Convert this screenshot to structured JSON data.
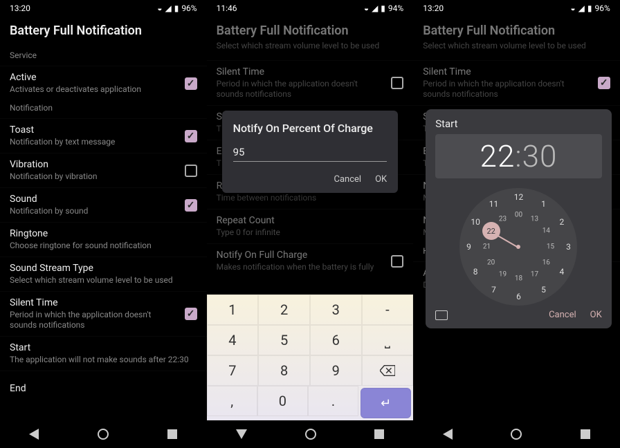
{
  "panels": [
    {
      "time": "13:20",
      "battery": "96%",
      "title": "Battery Full Notification",
      "sections": [
        {
          "header": "Service",
          "items": [
            {
              "title": "Active",
              "summary": "Activates or deactivates application",
              "checked": true
            }
          ]
        },
        {
          "header": "Notification",
          "items": [
            {
              "title": "Toast",
              "summary": "Notification by text message",
              "checked": true
            },
            {
              "title": "Vibration",
              "summary": "Notification by vibration",
              "checked": false
            },
            {
              "title": "Sound",
              "summary": "Notification by sound",
              "checked": true
            },
            {
              "title": "Ringtone",
              "summary": "Choose ringtone for sound notification"
            },
            {
              "title": "Sound Stream Type",
              "summary": "Select which stream volume level to be used"
            },
            {
              "title": "Silent Time",
              "summary": "Period in which the application doesn't sounds notifications",
              "checked": true
            },
            {
              "title": "Start",
              "summary": "The application will not make sounds after 22:30"
            },
            {
              "title": "End",
              "summary": ""
            }
          ]
        }
      ]
    },
    {
      "time": "11:46",
      "battery": "94%",
      "title": "Battery Full Notification",
      "subhead": "Select which stream volume level to be used",
      "bg_items": [
        {
          "title": "Silent Time",
          "summary": "Period in which the application doesn't sounds notifications",
          "checked": false
        },
        {
          "title": "S",
          "summary": "T"
        },
        {
          "title": "E",
          "summary": "T"
        },
        {
          "title": "R",
          "summary": "Time between notifications"
        },
        {
          "title": "Repeat Count",
          "summary": "Type 0 for infinite"
        },
        {
          "title": "Notify On Full Charge",
          "summary": "Makes notification when the battery is fully",
          "checked": false
        }
      ],
      "dialog": {
        "title": "Notify On Percent Of Charge",
        "value": "95",
        "cancel": "Cancel",
        "ok": "OK"
      },
      "keypad": [
        [
          "1",
          "2",
          "3",
          "-"
        ],
        [
          "4",
          "5",
          "6",
          "␣"
        ],
        [
          "7",
          "8",
          "9",
          "⌫"
        ],
        [
          ",",
          "0",
          ".",
          "↵"
        ]
      ]
    },
    {
      "time": "13:20",
      "battery": "96%",
      "title": "Battery Full Notification",
      "subhead": "Select which stream volume level to be used",
      "bg_items": [
        {
          "title": "Silent Time",
          "summary": "Period in which the application doesn't sounds notifications",
          "checked": true
        },
        {
          "title": "S",
          "summary": "T"
        },
        {
          "title": "E",
          "summary": "T"
        },
        {
          "title": "N",
          "summary": "M"
        },
        {
          "title": "N",
          "summary": "M                                                          above this percent"
        },
        {
          "title": "Help",
          "summary": ""
        },
        {
          "title": "About…",
          "summary": "Displays copyright information"
        }
      ],
      "clock": {
        "label": "Start",
        "hour": "22",
        "minute": "30",
        "cancel": "Cancel",
        "ok": "OK",
        "outer": [
          "12",
          "1",
          "2",
          "3",
          "4",
          "5",
          "6",
          "7",
          "8",
          "9",
          "10",
          "11"
        ],
        "inner": [
          "00",
          "13",
          "14",
          "15",
          "16",
          "17",
          "18",
          "19",
          "20",
          "21",
          "22",
          "23"
        ],
        "selected": "22"
      }
    }
  ]
}
